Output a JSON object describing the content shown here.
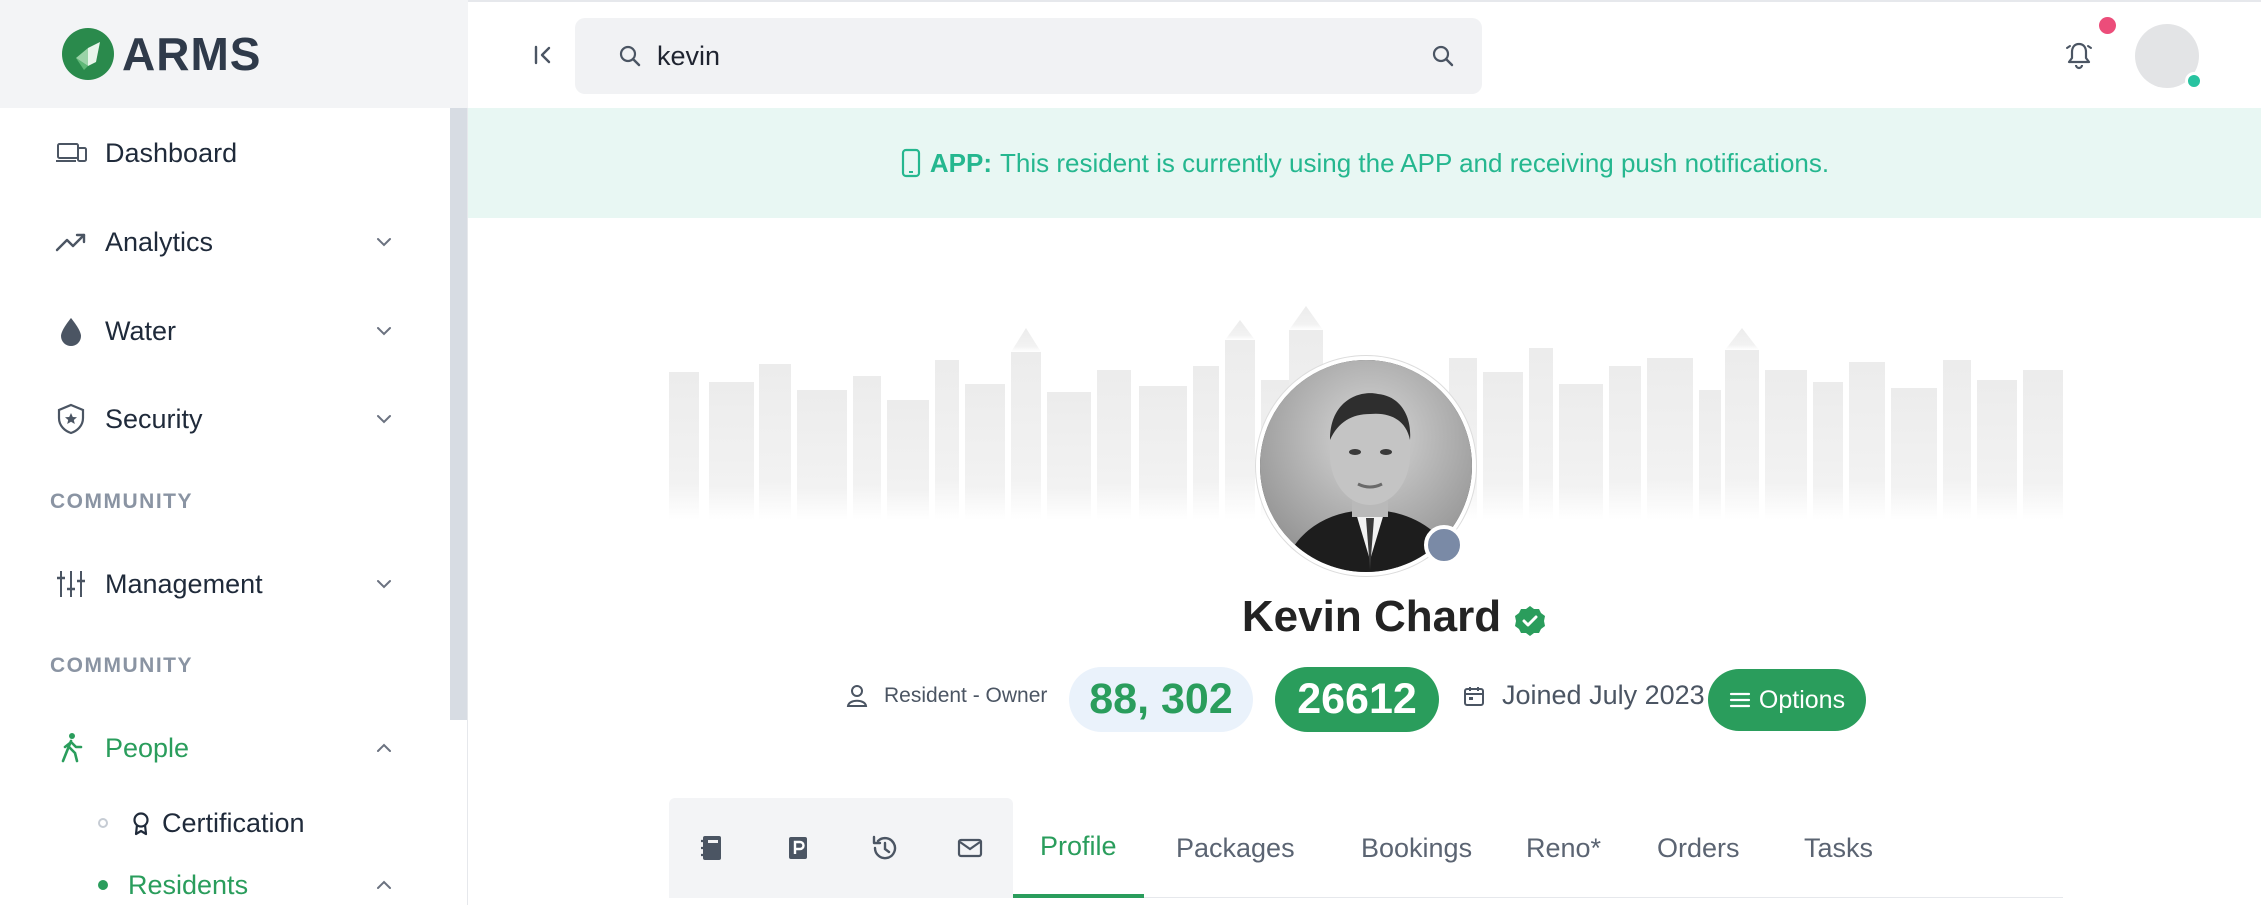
{
  "app": {
    "brand": "ARMS"
  },
  "sidebar": {
    "items": [
      {
        "label": "Dashboard"
      },
      {
        "label": "Analytics"
      },
      {
        "label": "Water"
      },
      {
        "label": "Security"
      }
    ],
    "section_1": "COMMUNITY",
    "management": {
      "label": "Management"
    },
    "section_2": "COMMUNITY",
    "people": {
      "label": "People"
    },
    "sub_items": [
      {
        "label": "Certification"
      },
      {
        "label": "Residents"
      }
    ]
  },
  "search": {
    "value": "kevin",
    "placeholder": ""
  },
  "banner": {
    "strong": "APP:",
    "message": "This resident is currently using the APP and receiving push notifications."
  },
  "profile": {
    "name": "Kevin Chard",
    "role": "Resident - Owner",
    "units": "88, 302",
    "id": "26612",
    "joined": "Joined July 2023",
    "options_label": "Options"
  },
  "tabs": [
    {
      "label": "Profile"
    },
    {
      "label": "Packages"
    },
    {
      "label": "Bookings"
    },
    {
      "label": "Reno*"
    },
    {
      "label": "Orders"
    },
    {
      "label": "Tasks"
    }
  ],
  "colors": {
    "brand_green": "#2a9d5c",
    "banner_bg": "#e8f7f3",
    "banner_text": "#25b78f",
    "notification_badge": "#ec4d7a",
    "online": "#28c3a0"
  },
  "icons": {
    "dashboard": "devices-icon",
    "analytics": "trend-up-icon",
    "water": "water-drop-icon",
    "security": "shield-star-icon",
    "management": "sliders-icon",
    "people": "person-walking-icon",
    "certification": "award-icon"
  }
}
